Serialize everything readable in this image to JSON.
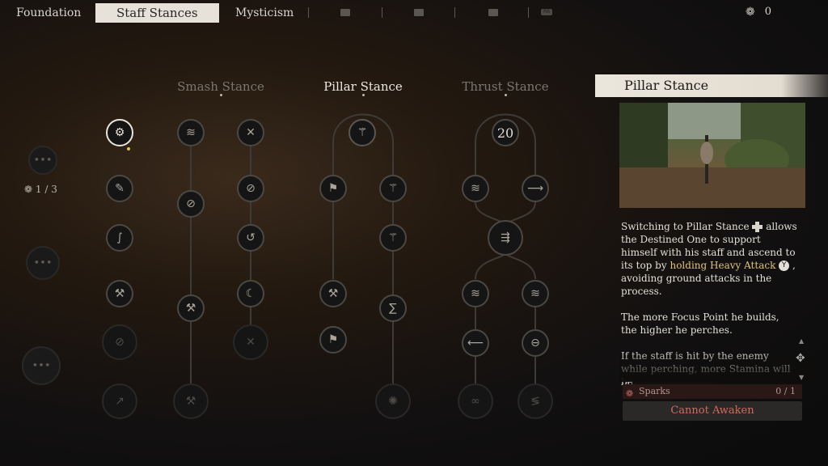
{
  "top_nav": {
    "tabs": [
      {
        "label": "Foundation"
      },
      {
        "label": "Staff Stances"
      },
      {
        "label": "Mysticism"
      }
    ],
    "locked_tab_icons": [
      "lock-icon",
      "lock-icon",
      "lock-icon",
      "lock-icon"
    ],
    "sparks_total": "0"
  },
  "left_column": {
    "spark_count": "1 / 3"
  },
  "stances": [
    {
      "name": "Smash Stance"
    },
    {
      "name": "Pillar Stance"
    },
    {
      "name": "Thrust Stance"
    }
  ],
  "tree": {
    "thrust_top_value": "20"
  },
  "detail_panel": {
    "title": "Pillar Stance",
    "desc_1_pre": "Switching to Pillar Stance",
    "desc_1_mid": "allows the Destined One to support himself with his staff and ascend to its top by",
    "desc_1_hl": "holding Heavy Attack",
    "desc_1_button": "Y",
    "desc_1_post": ", avoiding ground attacks in the process.",
    "desc_2": "The more Focus Point he builds, the higher he perches.",
    "desc_3": "If the staff is hit by the enemy while perching, more Stamina will be",
    "sparks_label": "Sparks",
    "sparks_value": "0 / 1",
    "awaken_label": "Cannot Awaken"
  },
  "colors": {
    "active_tab_bg": "#e6e2d9",
    "highlight_text": "#e0c37a",
    "awaken_text": "#d06a5c"
  }
}
